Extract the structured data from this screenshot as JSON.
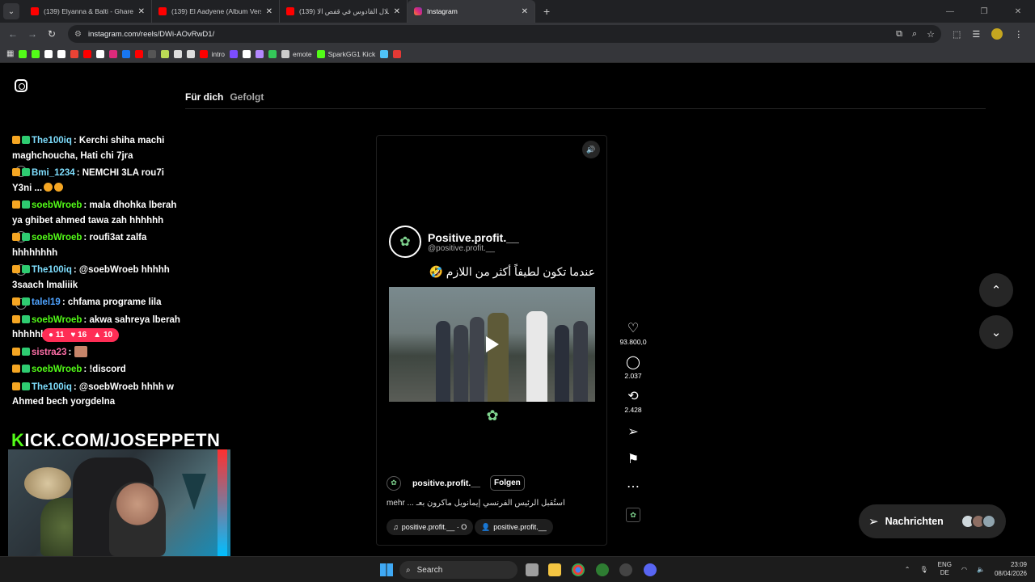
{
  "browser": {
    "tabs": [
      {
        "title": "(139) Elyanna & Balti - Ghareeb",
        "favicon": "youtube"
      },
      {
        "title": "(139) El Aadyene (Album Versio",
        "favicon": "youtube"
      },
      {
        "title": "(139) علال القادوس في قفص الا",
        "favicon": "youtube"
      },
      {
        "title": "Instagram",
        "favicon": "instagram",
        "active": true
      }
    ],
    "url": "instagram.com/reels/DWi-AOvRwD1/",
    "bookmarks": [
      {
        "label": "",
        "color": "#53fc18"
      },
      {
        "label": "",
        "color": "#53fc18"
      },
      {
        "label": "",
        "color": "#ffffff"
      },
      {
        "label": "",
        "color": "#ffffff"
      },
      {
        "label": "",
        "color": "#ea4335"
      },
      {
        "label": "",
        "color": "#ff0000"
      },
      {
        "label": "",
        "color": "#ffffff"
      },
      {
        "label": "",
        "color": "#dd2a7b"
      },
      {
        "label": "",
        "color": "#1877f2"
      },
      {
        "label": "",
        "color": "#ff0000"
      },
      {
        "label": "",
        "color": "#555555"
      },
      {
        "label": "",
        "color": "#bada55"
      },
      {
        "label": "",
        "color": "#dddddd"
      },
      {
        "label": "",
        "color": "#dddddd"
      },
      {
        "label": "intro",
        "color": "#ff0000"
      },
      {
        "label": "",
        "color": "#7c4dff"
      },
      {
        "label": "",
        "color": "#ffffff"
      },
      {
        "label": "",
        "color": "#b388ff"
      },
      {
        "label": "",
        "color": "#34c759"
      },
      {
        "label": "emote",
        "color": "#cccccc"
      },
      {
        "label": "SparkGG1 Kick",
        "color": "#53fc18"
      },
      {
        "label": "",
        "color": "#4fc3f7"
      },
      {
        "label": "",
        "color": "#e53935"
      }
    ]
  },
  "instagram": {
    "tab_for_you": "Für dich",
    "tab_following": "Gefolgt"
  },
  "chat": {
    "messages": [
      {
        "user": "The100iq",
        "color": "#7fdfff",
        "text": ": Kerchi shiha machi maghchoucha, Hati chi 7jra"
      },
      {
        "user": "Bmi_1234",
        "color": "#7fdfff",
        "text": ": NEMCHI 3LA rou7i Y3ni ..."
      },
      {
        "user": "soebWroeb",
        "color": "#53fc18",
        "text": ": mala dhohka lberah ya ghibet ahmed tawa zah hhhhhh"
      },
      {
        "user": "soebWroeb",
        "color": "#53fc18",
        "text": ": roufi3at zalfa hhhhhhhh"
      },
      {
        "user": "The100iq",
        "color": "#7fdfff",
        "text": ": @soebWroeb hhhhh 3saach lmaliiik"
      },
      {
        "user": "talel19",
        "color": "#4fa3ff",
        "text": ": chfama programe lila"
      },
      {
        "user": "soebWroeb",
        "color": "#53fc18",
        "text": ": akwa sahreya lberah hhhhhhhhhh"
      },
      {
        "user": "sistra23",
        "color": "#ff6fa8",
        "text": ":"
      },
      {
        "user": "soebWroeb",
        "color": "#53fc18",
        "text": ": !discord"
      },
      {
        "user": "The100iq",
        "color": "#7fdfff",
        "text": ": @soebWroeb hhhh w Ahmed bech yorgdelna"
      }
    ],
    "stats": {
      "viewers": "11",
      "likes": "16",
      "shares": "10"
    }
  },
  "stream": {
    "kick_prefix": "K",
    "kick_rest": "ICK.COM/JOSEPPETN"
  },
  "reel": {
    "author": "Positive.profit.__",
    "handle": "@positive.profit.__",
    "caption_ar": "عندما تكون لطيفاً أكثر من اللازم 🤣",
    "foot_user": "positive.profit.__",
    "follow": "Folgen",
    "caption_line": "mehr ... استُقبل الرئيس الفرنسي إيمانويل ماكرون بعـ",
    "audio_pill": "positive.profit.__ · O",
    "tag_pill": "positive.profit.__",
    "likes": "93.800,0",
    "comments": "2.037",
    "reposts": "2.428"
  },
  "messages_box": {
    "label": "Nachrichten"
  },
  "taskbar": {
    "search": "Search",
    "lang_top": "ENG",
    "lang_bottom": "DE",
    "time": "23:09",
    "date": "08/04/2026"
  }
}
